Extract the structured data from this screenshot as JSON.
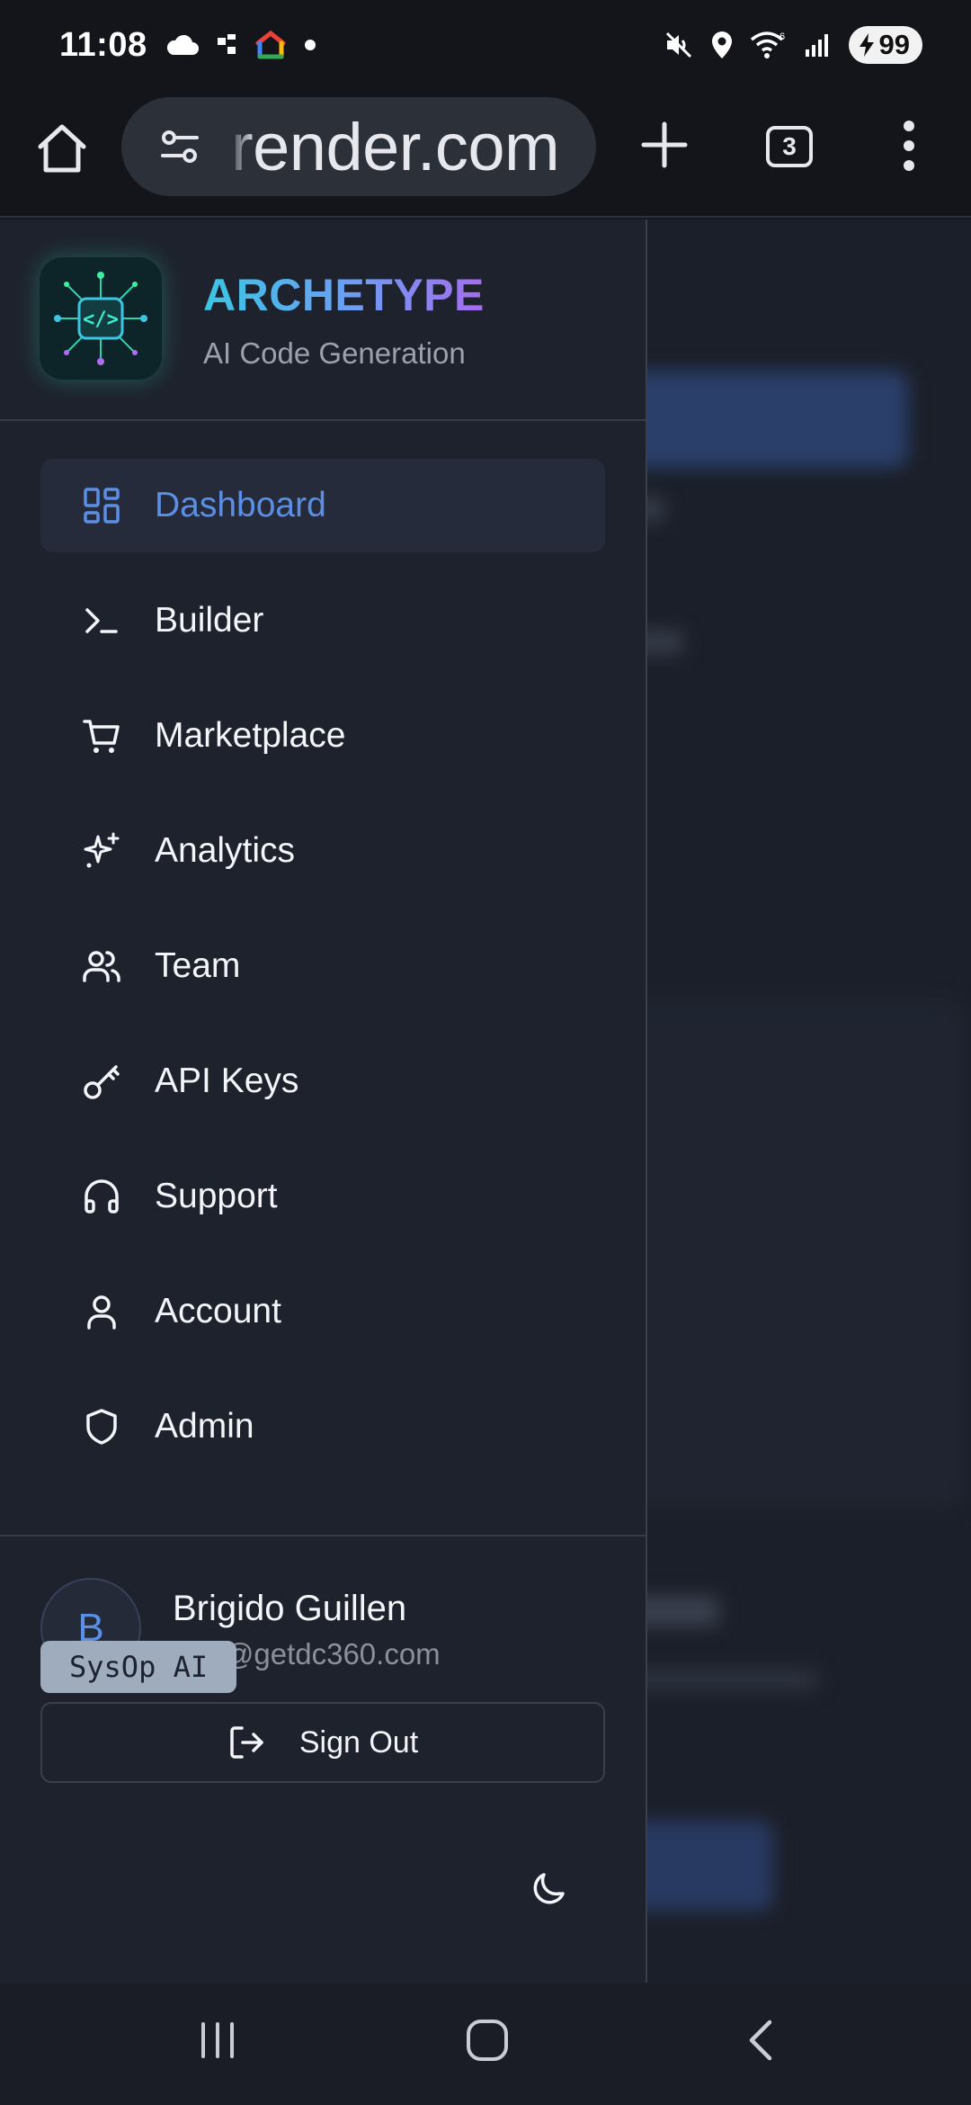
{
  "status_bar": {
    "time": "11:08",
    "battery": "99"
  },
  "browser": {
    "url": "render.com",
    "tab_count": "3"
  },
  "brand": {
    "title": "ARCHETYPE",
    "subtitle": "AI Code Generation",
    "logo_text": "</>"
  },
  "nav": {
    "items": [
      {
        "label": "Dashboard",
        "icon": "dashboard-icon",
        "active": true
      },
      {
        "label": "Builder",
        "icon": "terminal-icon",
        "active": false
      },
      {
        "label": "Marketplace",
        "icon": "cart-icon",
        "active": false
      },
      {
        "label": "Analytics",
        "icon": "sparkles-icon",
        "active": false
      },
      {
        "label": "Team",
        "icon": "users-icon",
        "active": false
      },
      {
        "label": "API Keys",
        "icon": "key-icon",
        "active": false
      },
      {
        "label": "Support",
        "icon": "headphones-icon",
        "active": false
      },
      {
        "label": "Account",
        "icon": "user-icon",
        "active": false
      },
      {
        "label": "Admin",
        "icon": "shield-icon",
        "active": false
      }
    ]
  },
  "user": {
    "initial": "B",
    "name": "Brigido Guillen",
    "email": "root@getdc360.com",
    "sign_out_label": "Sign Out"
  },
  "footer": {
    "badge": "SysOp AI"
  },
  "colors": {
    "accent": "#5b8fe6",
    "drawer_bg": "#1e222c",
    "active_item_bg": "#252b3a",
    "badge_bg": "#9eacbd"
  }
}
